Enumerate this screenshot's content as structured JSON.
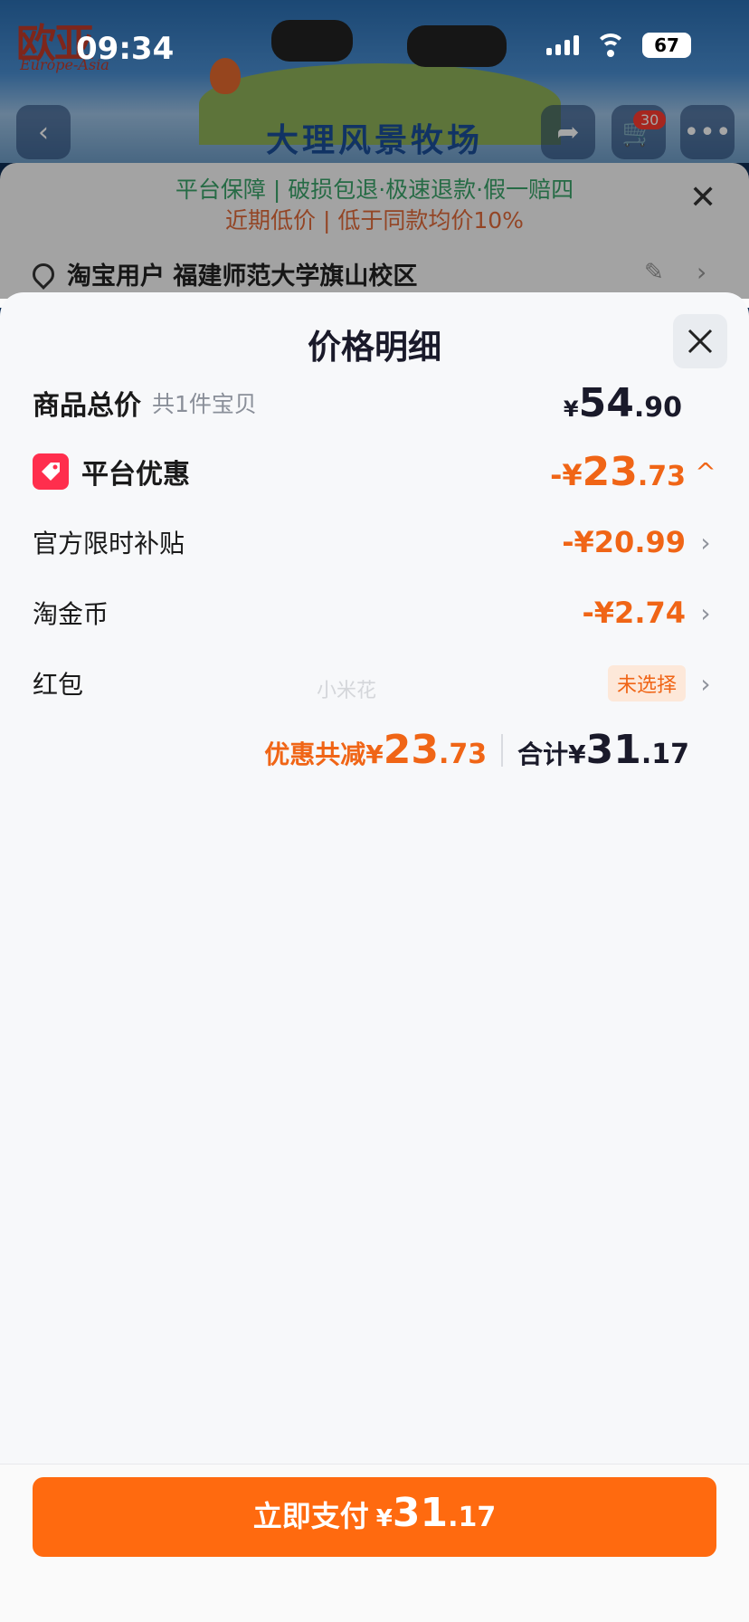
{
  "status_bar": {
    "time": "09:34",
    "battery": "67"
  },
  "background_page": {
    "brand_logo": "欧亚",
    "brand_logo_sub": "Europe-Asia",
    "store_title": "大理风景牧场",
    "cart_count": "30",
    "guarantee_line1": "平台保障 | 破损包退·极速退款·假一赔四",
    "guarantee_line2": "近期低价 | 低于同款均价10%",
    "address": "淘宝用户 福建师范大学旗山校区"
  },
  "modal": {
    "title": "价格明细",
    "goods_total": {
      "label": "商品总价",
      "sub": "共1件宝贝",
      "currency": "¥",
      "integer": "54",
      "decimal": ".90"
    },
    "platform_discount": {
      "label": "平台优惠",
      "prefix": "-¥",
      "integer": "23",
      "decimal": ".73",
      "toggle": "^"
    },
    "items": [
      {
        "label": "官方限时补贴",
        "value": "-¥20.99"
      },
      {
        "label": "淘金币",
        "value": "-¥2.74"
      },
      {
        "label": "红包",
        "pill": "未选择"
      }
    ],
    "watermark": "小米花",
    "summary": {
      "discount_label": "优惠共减¥",
      "discount_integer": "23",
      "discount_decimal": ".73",
      "total_label": "合计¥",
      "total_integer": "31",
      "total_decimal": ".17"
    },
    "pay_button": {
      "label": "立即支付",
      "currency": "¥",
      "integer": "31",
      "decimal": ".17"
    }
  },
  "colors": {
    "accent_orange": "#f06516",
    "pay_button": "#ff6a0f",
    "tag_red": "#ff2e4d"
  }
}
